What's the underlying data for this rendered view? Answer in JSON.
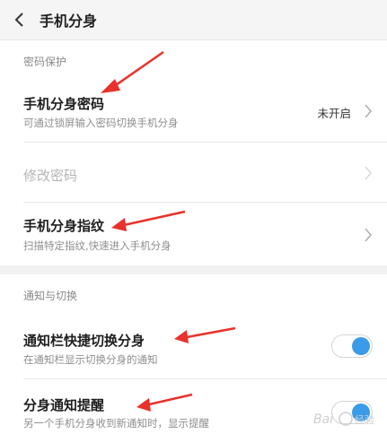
{
  "header": {
    "title": "手机分身",
    "back_icon": "chevron-left-icon"
  },
  "sections": {
    "password": {
      "label": "密码保护"
    },
    "notify": {
      "label": "通知与切换"
    }
  },
  "rows": {
    "clone_password": {
      "title": "手机分身密码",
      "subtitle": "可通过锁屏输入密码切换手机分身",
      "value": "未开启"
    },
    "change_password": {
      "title": "修改密码"
    },
    "clone_fingerprint": {
      "title": "手机分身指纹",
      "subtitle": "扫描特定指纹,快速进入手机分身"
    },
    "quick_switch": {
      "title": "通知栏快捷切换分身",
      "subtitle": "在通知栏显示切换分身的通知",
      "enabled": true
    },
    "notify_alert": {
      "title": "分身通知提醒",
      "subtitle": "另一个手机分身收到新通知时，显示提醒",
      "enabled": true
    }
  },
  "colors": {
    "toggle_on": "#3a9be8",
    "annotation_arrow": "#e8322b"
  }
}
